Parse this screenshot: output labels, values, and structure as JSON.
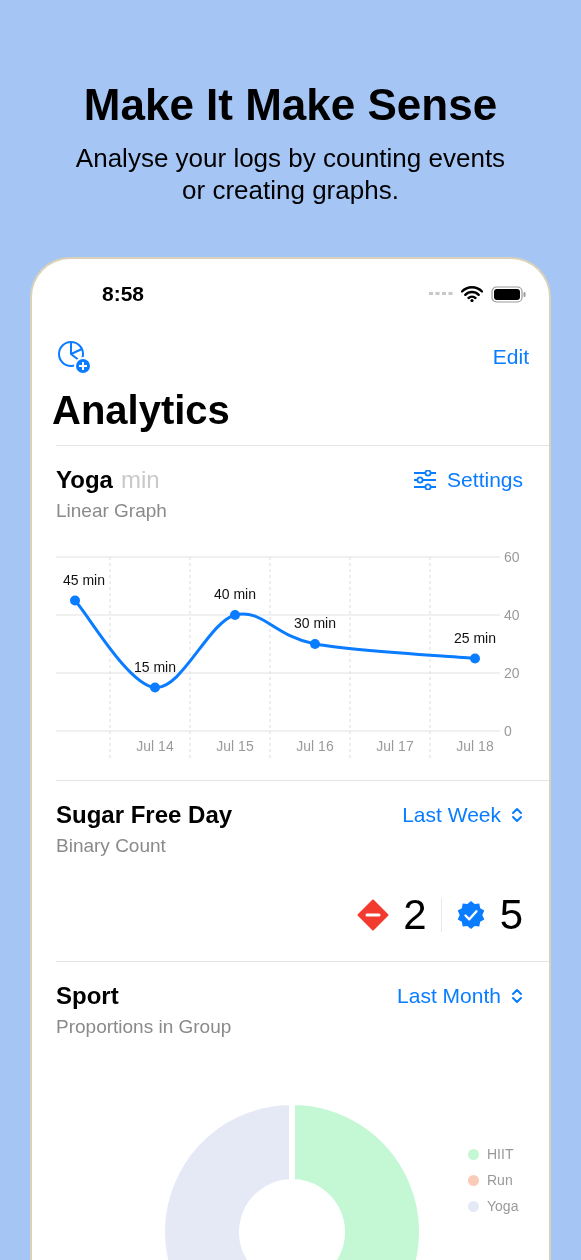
{
  "header": {
    "title": "Make It Make Sense",
    "subtitle": "Analyse your logs by counting events or creating graphs."
  },
  "status_bar": {
    "time": "8:58"
  },
  "nav": {
    "edit": "Edit",
    "title": "Analytics"
  },
  "cards": [
    {
      "kind": "line",
      "title": "Yoga",
      "unit": "min",
      "subtitle": "Linear Graph",
      "action": "Settings",
      "chart_data": {
        "type": "line",
        "categories": [
          null,
          "Jul 14",
          "Jul 15",
          "Jul 16",
          "Jul 17",
          "Jul 18"
        ],
        "series": [
          {
            "color": "#0a7cff",
            "marker": "circle",
            "values": [
              45,
              15,
              40,
              30,
              null,
              25
            ]
          }
        ],
        "value_labels": [
          "45 min",
          "15 min",
          "40 min",
          "30 min",
          null,
          "25 min"
        ],
        "ylim": [
          0,
          60
        ],
        "yticks": [
          0,
          20,
          40,
          60
        ]
      }
    },
    {
      "kind": "binary",
      "title": "Sugar Free Day",
      "subtitle": "Binary Count",
      "period": "Last Week",
      "counts": [
        {
          "kind": "negative",
          "value": "2"
        },
        {
          "kind": "positive",
          "value": "5"
        }
      ]
    },
    {
      "kind": "proportions",
      "title": "Sport",
      "subtitle": "Proportions in Group",
      "period": "Last Month",
      "legend": [
        {
          "label": "HIIT",
          "color": "#c4f8d4"
        },
        {
          "label": "Run",
          "color": "#f9cbb8"
        },
        {
          "label": "Yoga",
          "color": "#e4e9f5"
        }
      ]
    }
  ]
}
